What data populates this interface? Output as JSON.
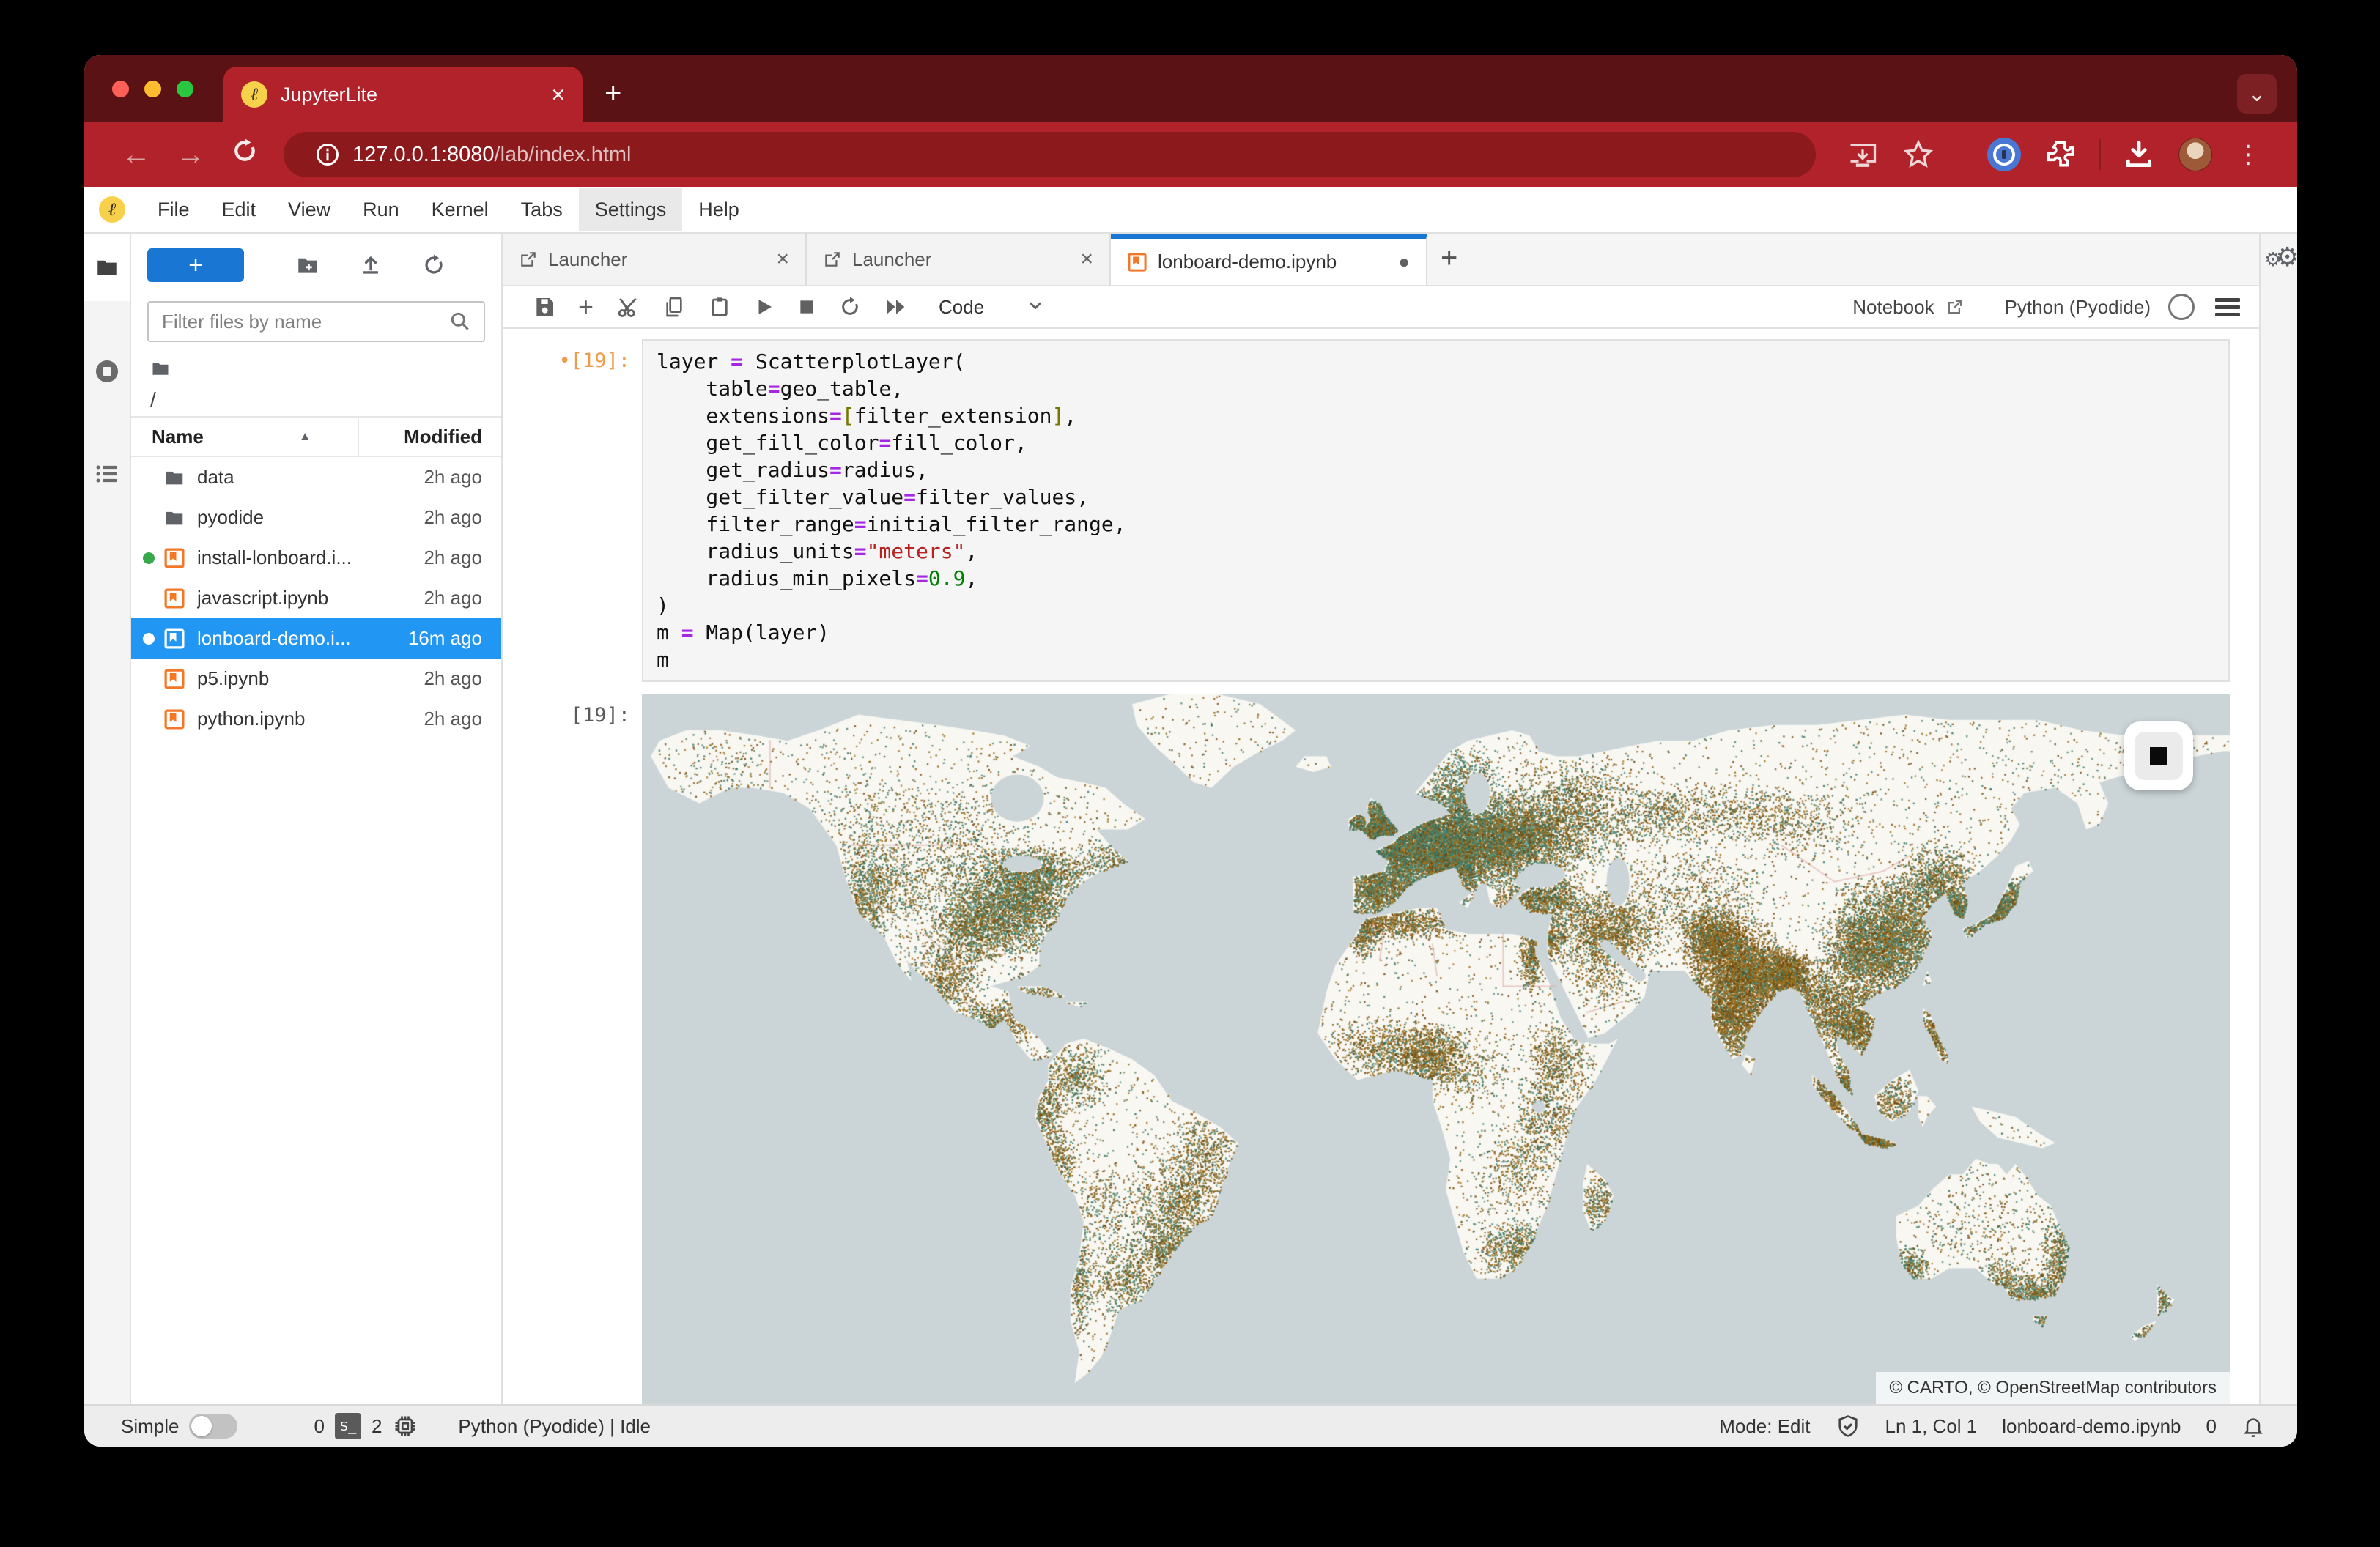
{
  "browser": {
    "tab_title": "JupyterLite",
    "url_host": "127.0.0.1:8080",
    "url_path": "/lab/index.html",
    "favicon_glyph": "ℓ",
    "colors": {
      "frame": "#5a1214",
      "toolbar": "#b2222a",
      "pill": "#8c191b",
      "accent_blue": "#1976d2"
    }
  },
  "menu": {
    "items": [
      "File",
      "Edit",
      "View",
      "Run",
      "Kernel",
      "Tabs",
      "Settings",
      "Help"
    ],
    "active": "Settings"
  },
  "sidebar": {
    "filter_placeholder": "Filter files by name",
    "breadcrumb": "/",
    "columns": {
      "name": "Name",
      "modified": "Modified"
    },
    "files": [
      {
        "name": "data",
        "type": "folder",
        "modified": "2h ago",
        "running": false,
        "selected": false
      },
      {
        "name": "pyodide",
        "type": "folder",
        "modified": "2h ago",
        "running": false,
        "selected": false
      },
      {
        "name": "install-lonboard.i...",
        "type": "notebook",
        "modified": "2h ago",
        "running": true,
        "selected": false
      },
      {
        "name": "javascript.ipynb",
        "type": "notebook",
        "modified": "2h ago",
        "running": false,
        "selected": false
      },
      {
        "name": "lonboard-demo.i...",
        "type": "notebook",
        "modified": "16m ago",
        "running": true,
        "selected": true
      },
      {
        "name": "p5.ipynb",
        "type": "notebook",
        "modified": "2h ago",
        "running": false,
        "selected": false
      },
      {
        "name": "python.ipynb",
        "type": "notebook",
        "modified": "2h ago",
        "running": false,
        "selected": false
      }
    ]
  },
  "doc_tabs": [
    {
      "label": "Launcher",
      "active": false,
      "dirty": false
    },
    {
      "label": "Launcher",
      "active": false,
      "dirty": false
    },
    {
      "label": "lonboard-demo.ipynb",
      "active": true,
      "dirty": true
    }
  ],
  "notebook_toolbar": {
    "cell_type": "Code",
    "right_label": "Notebook",
    "kernel_name": "Python (Pyodide)"
  },
  "cell": {
    "input_prompt": "[19]:",
    "input_prompt_dot": "•",
    "output_prompt": "[19]:",
    "code": [
      [
        [
          "layer ",
          ""
        ],
        [
          "=",
          "op"
        ],
        [
          " ScatterplotLayer(",
          ""
        ]
      ],
      [
        [
          "    table",
          ""
        ],
        [
          "=",
          "op"
        ],
        [
          "geo_table,",
          ""
        ]
      ],
      [
        [
          "    extensions",
          ""
        ],
        [
          "=",
          "op"
        ],
        [
          "[",
          "brk"
        ],
        [
          "filter_extension",
          ""
        ],
        [
          "]",
          "brk"
        ],
        [
          ",",
          ""
        ]
      ],
      [
        [
          "    get_fill_color",
          ""
        ],
        [
          "=",
          "op"
        ],
        [
          "fill_color,",
          ""
        ]
      ],
      [
        [
          "    get_radius",
          ""
        ],
        [
          "=",
          "op"
        ],
        [
          "radius,",
          ""
        ]
      ],
      [
        [
          "    get_filter_value",
          ""
        ],
        [
          "=",
          "op"
        ],
        [
          "filter_values,",
          ""
        ]
      ],
      [
        [
          "    filter_range",
          ""
        ],
        [
          "=",
          "op"
        ],
        [
          "initial_filter_range,",
          ""
        ]
      ],
      [
        [
          "    radius_units",
          ""
        ],
        [
          "=",
          "op"
        ],
        [
          "\"meters\"",
          "str"
        ],
        [
          ",",
          ""
        ]
      ],
      [
        [
          "    radius_min_pixels",
          ""
        ],
        [
          "=",
          "op"
        ],
        [
          "0.9",
          "num"
        ],
        [
          ",",
          ""
        ]
      ],
      [
        [
          ")",
          ""
        ]
      ],
      [
        [
          "m ",
          ""
        ],
        [
          "=",
          "op"
        ],
        [
          " Map(layer)",
          ""
        ]
      ],
      [
        [
          "m",
          ""
        ]
      ]
    ]
  },
  "map": {
    "attribution": "© CARTO, © OpenStreetMap contributors",
    "ocean": "#cbd5d8",
    "land": "#f8f7f2",
    "border_color": "rgba(226,172,168,0.6)",
    "browns": [
      "#7b5010",
      "#8f6414",
      "#9c6f1d",
      "#6b470e",
      "#a97e2e"
    ],
    "greens": [
      "#41806f",
      "#52876f",
      "#2f705f",
      "#5d8d74"
    ],
    "sparse_dots": 5000,
    "clusters": [
      [
        -100,
        40,
        14,
        9,
        900,
        0.55
      ],
      [
        -85,
        38,
        10,
        7,
        2600,
        0.5
      ],
      [
        -95,
        33,
        6,
        4,
        700,
        0.55
      ],
      [
        -120,
        38,
        4,
        8,
        650,
        0.5
      ],
      [
        -113,
        43,
        6,
        6,
        300,
        0.5
      ],
      [
        -80,
        44,
        8,
        3,
        550,
        0.5
      ],
      [
        -63,
        46,
        6,
        3,
        250,
        0.5
      ],
      [
        -122,
        53,
        8,
        8,
        200,
        0.55
      ],
      [
        -101,
        53,
        14,
        6,
        300,
        0.55
      ],
      [
        -150,
        62,
        8,
        5,
        90,
        0.55
      ],
      [
        -102,
        23,
        6,
        5,
        650,
        0.65
      ],
      [
        -90,
        15,
        6,
        3,
        420,
        0.7
      ],
      [
        -78,
        21,
        7,
        3,
        260,
        0.7
      ],
      [
        -73,
        5,
        6,
        5,
        520,
        0.6
      ],
      [
        -79,
        -2,
        3,
        4,
        260,
        0.65
      ],
      [
        -76,
        -11,
        3,
        5,
        260,
        0.65
      ],
      [
        -65,
        -20,
        5,
        5,
        260,
        0.6
      ],
      [
        -48,
        -20,
        8,
        7,
        950,
        0.65
      ],
      [
        -43,
        -10,
        6,
        6,
        480,
        0.68
      ],
      [
        -52,
        -28,
        5,
        4,
        420,
        0.6
      ],
      [
        -60,
        -34,
        6,
        5,
        480,
        0.58
      ],
      [
        -71,
        -33,
        2,
        8,
        300,
        0.6
      ],
      [
        -3,
        53,
        4,
        4,
        1150,
        0.45
      ],
      [
        -8,
        53,
        3,
        2,
        260,
        0.45
      ],
      [
        -4,
        40,
        6,
        4,
        1100,
        0.55
      ],
      [
        2,
        47,
        7,
        5,
        1900,
        0.45
      ],
      [
        9,
        51,
        8,
        6,
        2900,
        0.42
      ],
      [
        13,
        43,
        4,
        5,
        1100,
        0.5
      ],
      [
        20,
        48,
        8,
        5,
        1900,
        0.48
      ],
      [
        24,
        52,
        8,
        5,
        1300,
        0.52
      ],
      [
        31,
        50,
        8,
        5,
        1300,
        0.55
      ],
      [
        41,
        55,
        10,
        7,
        1500,
        0.6
      ],
      [
        16,
        60,
        6,
        5,
        650,
        0.42
      ],
      [
        33,
        39,
        7,
        3,
        950,
        0.65
      ],
      [
        45,
        34,
        7,
        5,
        650,
        0.72
      ],
      [
        52,
        33,
        7,
        5,
        700,
        0.72
      ],
      [
        47,
        25,
        6,
        5,
        300,
        0.75
      ],
      [
        31,
        28,
        2,
        5,
        330,
        0.75
      ],
      [
        3,
        34,
        10,
        2,
        650,
        0.75
      ],
      [
        -7,
        32,
        3,
        3,
        300,
        0.7
      ],
      [
        8,
        9,
        6,
        4,
        900,
        0.75
      ],
      [
        -3,
        10,
        8,
        4,
        650,
        0.75
      ],
      [
        15,
        6,
        8,
        5,
        380,
        0.72
      ],
      [
        38,
        8,
        5,
        5,
        520,
        0.72
      ],
      [
        35,
        -3,
        5,
        6,
        480,
        0.7
      ],
      [
        28,
        -13,
        6,
        6,
        380,
        0.68
      ],
      [
        28,
        -28,
        6,
        4,
        520,
        0.62
      ],
      [
        47,
        -19,
        3,
        5,
        260,
        0.65
      ],
      [
        68,
        40,
        12,
        6,
        550,
        0.62
      ],
      [
        72,
        32,
        5,
        4,
        1150,
        0.75
      ],
      [
        77,
        27,
        7,
        5,
        2100,
        0.8
      ],
      [
        77,
        17,
        6,
        6,
        1900,
        0.8
      ],
      [
        85,
        24,
        6,
        4,
        1300,
        0.8
      ],
      [
        90,
        24,
        3,
        3,
        750,
        0.8
      ],
      [
        96,
        20,
        4,
        5,
        480,
        0.72
      ],
      [
        101,
        15,
        5,
        5,
        750,
        0.7
      ],
      [
        106,
        13,
        4,
        6,
        650,
        0.7
      ],
      [
        102,
        3,
        3,
        3,
        300,
        0.7
      ],
      [
        107,
        -7,
        6,
        2,
        1000,
        0.75
      ],
      [
        99,
        1,
        4,
        4,
        420,
        0.7
      ],
      [
        113,
        0,
        4,
        4,
        300,
        0.68
      ],
      [
        122,
        12,
        4,
        6,
        550,
        0.7
      ],
      [
        113,
        31,
        9,
        8,
        3300,
        0.58
      ],
      [
        105,
        28,
        6,
        6,
        900,
        0.6
      ],
      [
        123,
        42,
        6,
        5,
        850,
        0.58
      ],
      [
        127,
        36,
        3,
        3,
        500,
        0.52
      ],
      [
        137,
        36,
        6,
        4,
        950,
        0.5
      ],
      [
        140,
        38,
        3,
        4,
        300,
        0.5
      ],
      [
        76,
        55,
        14,
        4,
        550,
        0.6
      ],
      [
        60,
        55,
        8,
        4,
        400,
        0.6
      ],
      [
        93,
        53,
        10,
        4,
        300,
        0.6
      ],
      [
        117,
        -32,
        3,
        3,
        260,
        0.55
      ],
      [
        138,
        -34,
        3,
        3,
        200,
        0.55
      ],
      [
        145,
        -37,
        4,
        3,
        420,
        0.55
      ],
      [
        151,
        -31,
        3,
        6,
        480,
        0.55
      ],
      [
        147,
        -42,
        2,
        2,
        90,
        0.55
      ],
      [
        133,
        -24,
        12,
        8,
        260,
        0.6
      ],
      [
        174,
        -38,
        2,
        3,
        130,
        0.55
      ],
      [
        170,
        -44,
        2,
        3,
        90,
        0.55
      ],
      [
        35,
        31,
        3,
        3,
        300,
        0.7
      ]
    ]
  },
  "status_bar": {
    "simple_label": "Simple",
    "terminals": "0",
    "kernels": "2",
    "kernel_status": "Python (Pyodide) | Idle",
    "mode": "Mode: Edit",
    "cursor": "Ln 1, Col 1",
    "filename": "lonboard-demo.ipynb",
    "notifications": "0"
  }
}
